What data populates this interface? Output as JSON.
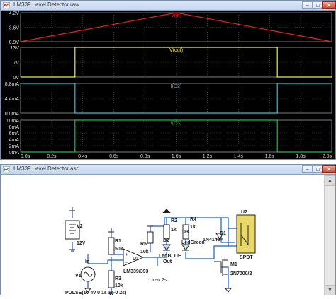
{
  "plot_window": {
    "title": "LM339 Level Detector.raw",
    "buttons": {
      "minimize": "–",
      "maximize": "□",
      "close": "✕"
    }
  },
  "schematic_window": {
    "title": "LM339 Level Detector.asc",
    "buttons": {
      "minimize": "–",
      "maximize": "□",
      "close": "✕"
    }
  },
  "chart_data": [
    {
      "type": "line",
      "title": "V(in)",
      "color": "#e8231c",
      "x": [
        0,
        1.0,
        2.0
      ],
      "y": [
        0.9,
        4.2,
        0.9
      ],
      "ylim": [
        0.9,
        4.2
      ],
      "yticks": [
        "4.2V",
        "3.6V",
        "0.9V"
      ]
    },
    {
      "type": "line",
      "title": "V(out)",
      "color": "#f2f033",
      "x": [
        0,
        0.35,
        0.35,
        1.65,
        1.65,
        2.0
      ],
      "y": [
        0,
        0,
        13,
        13,
        0,
        0
      ],
      "ylim": [
        0,
        13
      ],
      "yticks": [
        "13V",
        "7V",
        "0V"
      ]
    },
    {
      "type": "line",
      "title": "I(D2)",
      "color": "#2ec4d6",
      "x": [
        0,
        0.35,
        0.35,
        1.65,
        1.65,
        2.0
      ],
      "y": [
        8.8,
        8.8,
        0,
        0,
        8.8,
        8.8
      ],
      "ylim": [
        0,
        8.8
      ],
      "yticks": [
        "8.8mA",
        "4.4mA",
        "0.0mA"
      ]
    },
    {
      "type": "line",
      "title": "I(D3)",
      "color": "#1fbf3a",
      "x": [
        0,
        0.35,
        0.35,
        1.65,
        1.65,
        2.0
      ],
      "y": [
        0,
        0,
        10,
        10,
        0,
        0
      ],
      "ylim": [
        0,
        10
      ],
      "yticks": [
        "10mA",
        "8mA",
        "6mA",
        "4mA",
        "2mA",
        "0mA"
      ],
      "xticks": [
        "0.0s",
        "0.2s",
        "0.4s",
        "0.6s",
        "0.8s",
        "1.0s",
        "1.2s",
        "1.4s",
        "1.6s",
        "1.8s",
        "2.0s"
      ]
    }
  ],
  "schematic": {
    "labels": {
      "V2": "V2",
      "V2val": "12V",
      "R1": "R1",
      "R1val": "50k",
      "R3": "R3",
      "R3val": "10k",
      "R5": "R5",
      "R5val": "10k",
      "R2": "R2",
      "R2val": "1k",
      "R4": "R4",
      "R4val": "1k",
      "D2": "D2",
      "D2val": "LedBLUE",
      "D3": "D3",
      "D3val": "LedGreen",
      "D1": "D1",
      "D1val": "1N4148",
      "M1": "M1",
      "M1val": "2N7000/2",
      "U1": "U1",
      "U1val": "LM339/393",
      "U2": "U2",
      "U2val": "SPDT",
      "V1": "V1",
      "in": "In",
      "out": "Out",
      "tran": ".tran 2s",
      "pulse": "PULSE(1v 4v 0 1s 1s 0 2s)"
    }
  }
}
